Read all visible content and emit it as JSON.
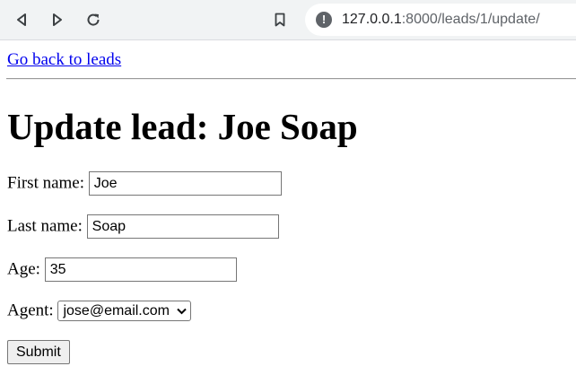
{
  "browser": {
    "url_host": "127.0.0.1",
    "url_rest": ":8000/leads/1/update/"
  },
  "page": {
    "back_link": "Go back to leads",
    "heading": "Update lead: Joe Soap"
  },
  "form": {
    "first_name_label": "First name:",
    "first_name_value": "Joe",
    "last_name_label": "Last name:",
    "last_name_value": "Soap",
    "age_label": "Age:",
    "age_value": "35",
    "agent_label": "Agent:",
    "agent_selected": "jose@email.com",
    "submit_label": "Submit"
  },
  "icons": {
    "back": "back-icon",
    "forward": "forward-icon",
    "reload": "reload-icon",
    "bookmark": "bookmark-icon",
    "site_info": "info-icon",
    "select_arrow": "chevron-down-icon"
  }
}
